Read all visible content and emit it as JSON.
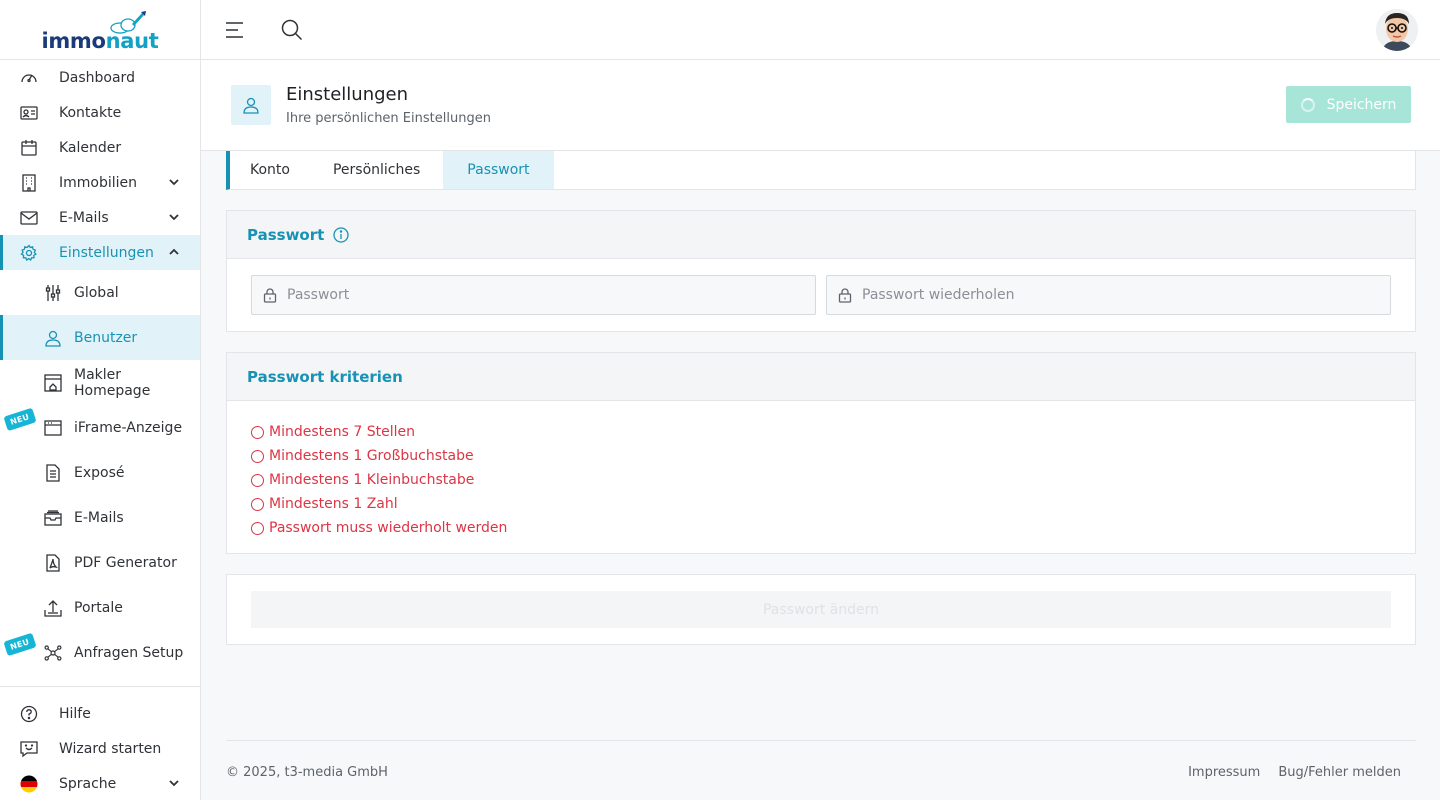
{
  "brand": {
    "logo_part1": "immo",
    "logo_part2": "naut"
  },
  "colors": {
    "accent": "#1892b4",
    "active_bg": "#e1f3f8",
    "error": "#dc3545",
    "save_disabled": "#a7e5d9",
    "badge": "#16b5d6"
  },
  "sidebar": {
    "items": [
      {
        "label": "Dashboard",
        "icon": "dashboard-gauge-icon"
      },
      {
        "label": "Kontakte",
        "icon": "contact-card-icon"
      },
      {
        "label": "Kalender",
        "icon": "calendar-icon"
      },
      {
        "label": "Immobilien",
        "icon": "building-icon"
      },
      {
        "label": "E-Mails",
        "icon": "envelope-icon"
      },
      {
        "label": "Einstellungen",
        "icon": "gear-icon"
      }
    ],
    "sub_items": [
      {
        "label": "Global",
        "icon": "sliders-icon"
      },
      {
        "label": "Benutzer",
        "icon": "user-icon"
      },
      {
        "label": "Makler Homepage",
        "icon": "homepage-icon"
      },
      {
        "label": "iFrame-Anzeige",
        "icon": "browser-window-icon",
        "badge": "NEU"
      },
      {
        "label": "Exposé",
        "icon": "document-icon"
      },
      {
        "label": "E-Mails",
        "icon": "inbox-icon"
      },
      {
        "label": "PDF Generator",
        "icon": "pdf-icon"
      },
      {
        "label": "Portale",
        "icon": "upload-icon"
      },
      {
        "label": "Anfragen Setup",
        "icon": "network-icon",
        "badge": "NEU"
      }
    ],
    "bottom_items": [
      {
        "label": "Hilfe",
        "icon": "help-circle-icon"
      },
      {
        "label": "Wizard starten",
        "icon": "chat-smile-icon"
      },
      {
        "label": "Sprache",
        "icon": "german-flag-icon"
      }
    ]
  },
  "header": {
    "title": "Einstellungen",
    "subtitle": "Ihre persönlichen Einstellungen",
    "save_label": "Speichern"
  },
  "tabs": [
    {
      "label": "Konto"
    },
    {
      "label": "Persönliches"
    },
    {
      "label": "Passwort",
      "active": true
    }
  ],
  "password_card": {
    "title": "Passwort",
    "password_placeholder": "Passwort",
    "repeat_placeholder": "Passwort wiederholen"
  },
  "criteria_card": {
    "title": "Passwort kriterien",
    "items": [
      "Mindestens 7 Stellen",
      "Mindestens 1 Großbuchstabe",
      "Mindestens 1 Kleinbuchstabe",
      "Mindestens 1 Zahl",
      "Passwort muss wiederholt werden"
    ]
  },
  "change_button_label": "Passwort ändern",
  "footer": {
    "copyright": "© 2025, t3-media GmbH",
    "impressum": "Impressum",
    "bug_report": "Bug/Fehler melden"
  }
}
